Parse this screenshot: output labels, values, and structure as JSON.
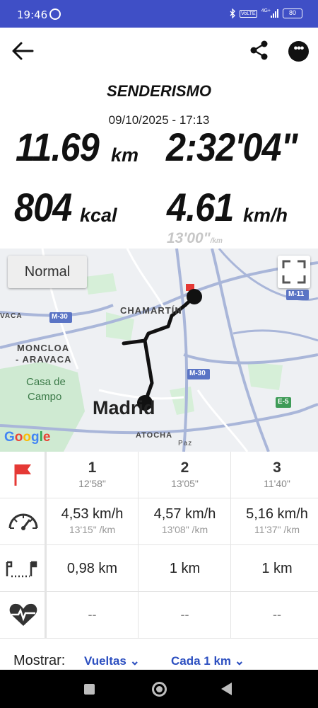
{
  "status_bar": {
    "time": "19:46",
    "battery": "80",
    "network": "4G+",
    "volte": "VoLTE"
  },
  "header": {
    "activity": "SENDERISMO",
    "datetime": "09/10/2025 - 17:13"
  },
  "stats": {
    "distance": {
      "value": "11.69",
      "unit": "km"
    },
    "duration": {
      "value": "2:32'04\""
    },
    "calories": {
      "value": "804",
      "unit": "kcal"
    },
    "speed": {
      "value": "4.61",
      "unit": "km/h"
    },
    "pace": {
      "value": "13'00\"",
      "unit": "/km"
    }
  },
  "map": {
    "mode_button": "Normal",
    "labels": {
      "chamartin": "CHAMARTÍN",
      "moncloa": "MONCLOA",
      "aravaca": "- ARAVACA",
      "casa": "Casa de",
      "campo": "Campo",
      "madrid": "Madrid",
      "atocha": "ATOCHA",
      "vaca": "VACA",
      "m30a": "M-30",
      "m30b": "M-30",
      "m11": "M-11",
      "e5": "E-5",
      "paz": "Paz",
      "google": "Google"
    }
  },
  "laps": [
    {
      "num": "1",
      "time": "12'58\"",
      "speed": "4,53 km/h",
      "pace": "13'15\" /km",
      "distance": "0,98 km",
      "hr": "--"
    },
    {
      "num": "2",
      "time": "13'05\"",
      "speed": "4,57 km/h",
      "pace": "13'08\" /km",
      "distance": "1 km",
      "hr": "--"
    },
    {
      "num": "3",
      "time": "11'40\"",
      "speed": "5,16 km/h",
      "pace": "11'37\" /km",
      "distance": "1 km",
      "hr": "--"
    }
  ],
  "footer": {
    "show_label": "Mostrar:",
    "dropdown1": "Vueltas",
    "dropdown2": "Cada 1 km"
  },
  "colors": {
    "status_bar": "#3F4FC6",
    "accent": "#2C4FC0",
    "flag": "#E53935"
  }
}
